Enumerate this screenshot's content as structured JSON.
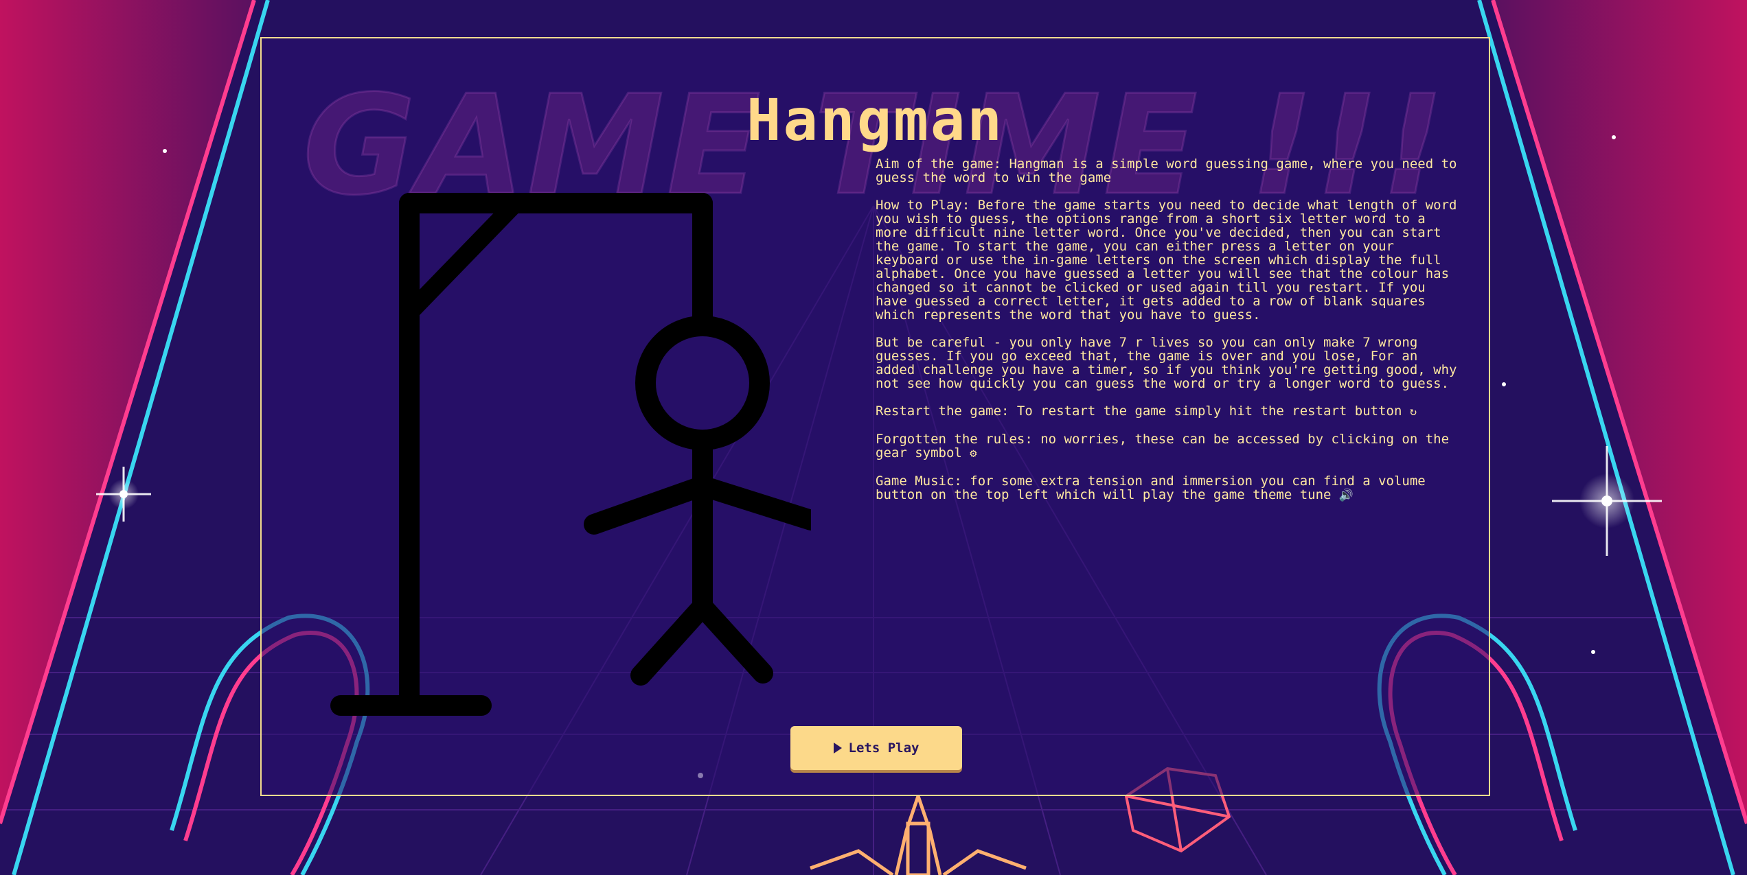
{
  "colors": {
    "accent": "#ffd98a",
    "panel_border": "#f3dd8e",
    "text": "#ffe8a0",
    "neon_pink": "#ff3d8f",
    "neon_cyan": "#39d6f0",
    "background": "#1f0f5e"
  },
  "background": {
    "watermark": "GAME TIME !!!"
  },
  "game": {
    "title": "Hangman"
  },
  "rules": {
    "aim": "Aim of the game: Hangman is a simple word guessing game, where you need to guess the word to win the game",
    "how_to_play": "How to Play: Before the game starts you need to decide what length of word you wish to guess, the options range from a short six letter word to a more difficult nine letter word. Once you've decided, then you can start the game. To start the game, you can either press a letter on your keyboard or use the in-game letters on the screen which display the full alphabet. Once you have guessed a letter you will see that the colour has changed so it cannot be clicked or used again till you restart. If you have guessed a correct letter, it gets added to a row of blank squares which represents the word that you have to guess.",
    "careful": "But be careful - you only have 7 r lives so you can only make 7 wrong guesses. If you go exceed that, the game is over and you lose, For an added challenge you have a timer, so if you think you're getting good, why not see how quickly you can guess the word or try a longer word to guess.",
    "restart": "Restart the game: To restart the game simply hit the restart button",
    "restart_icon": "↻",
    "forgotten": "Forgotten the rules: no worries, these can be accessed by clicking on the gear symbol",
    "gear_icon": "⚙",
    "music": "Game Music: for some extra tension and immersion you can find a volume button on the top left which will play the game theme tune",
    "volume_icon": "🔊"
  },
  "actions": {
    "play_label": "Lets Play",
    "play_icon": "play-icon"
  }
}
